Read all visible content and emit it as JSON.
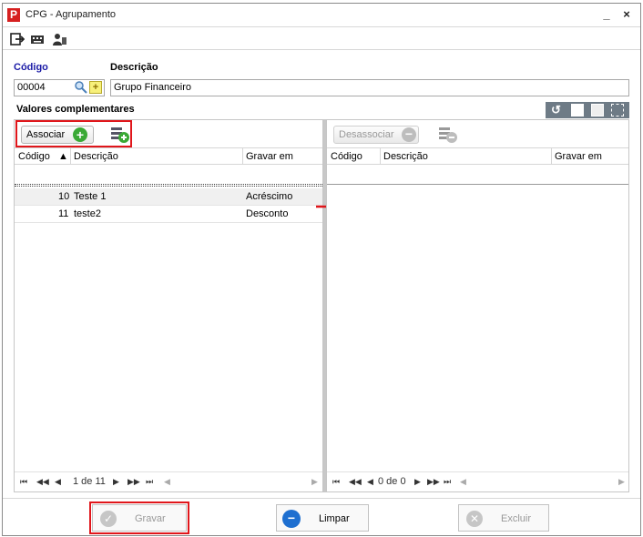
{
  "window": {
    "title": "CPG - Agrupamento",
    "app_icon": "P",
    "minimize": "_",
    "close": "×"
  },
  "toolbar": {
    "icons": [
      "exit-icon",
      "keyboard-icon",
      "users-icon"
    ]
  },
  "form": {
    "codigo_label": "Código",
    "codigo_value": "00004",
    "descricao_label": "Descrição",
    "descricao_value": "Grupo Financeiro"
  },
  "section": {
    "title": "Valores complementares"
  },
  "left_panel": {
    "associate_label": "Associar",
    "columns": [
      "Código",
      "Descrição",
      "Gravar em"
    ],
    "rows": [
      {
        "codigo": "10",
        "descricao": "Teste 1",
        "gravar": "Acréscimo"
      },
      {
        "codigo": "11",
        "descricao": "teste2",
        "gravar": "Desconto"
      }
    ],
    "pager": "1 de 11"
  },
  "right_panel": {
    "disassociate_label": "Desassociar",
    "columns": [
      "Código",
      "Descrição",
      "Gravar em"
    ],
    "pager": "0 de 0"
  },
  "footer": {
    "save": "Gravar",
    "clear": "Limpar",
    "delete": "Excluir"
  },
  "colors": {
    "accent": "#1a1aa6",
    "highlight": "#e0161b",
    "green": "#3aa935"
  }
}
